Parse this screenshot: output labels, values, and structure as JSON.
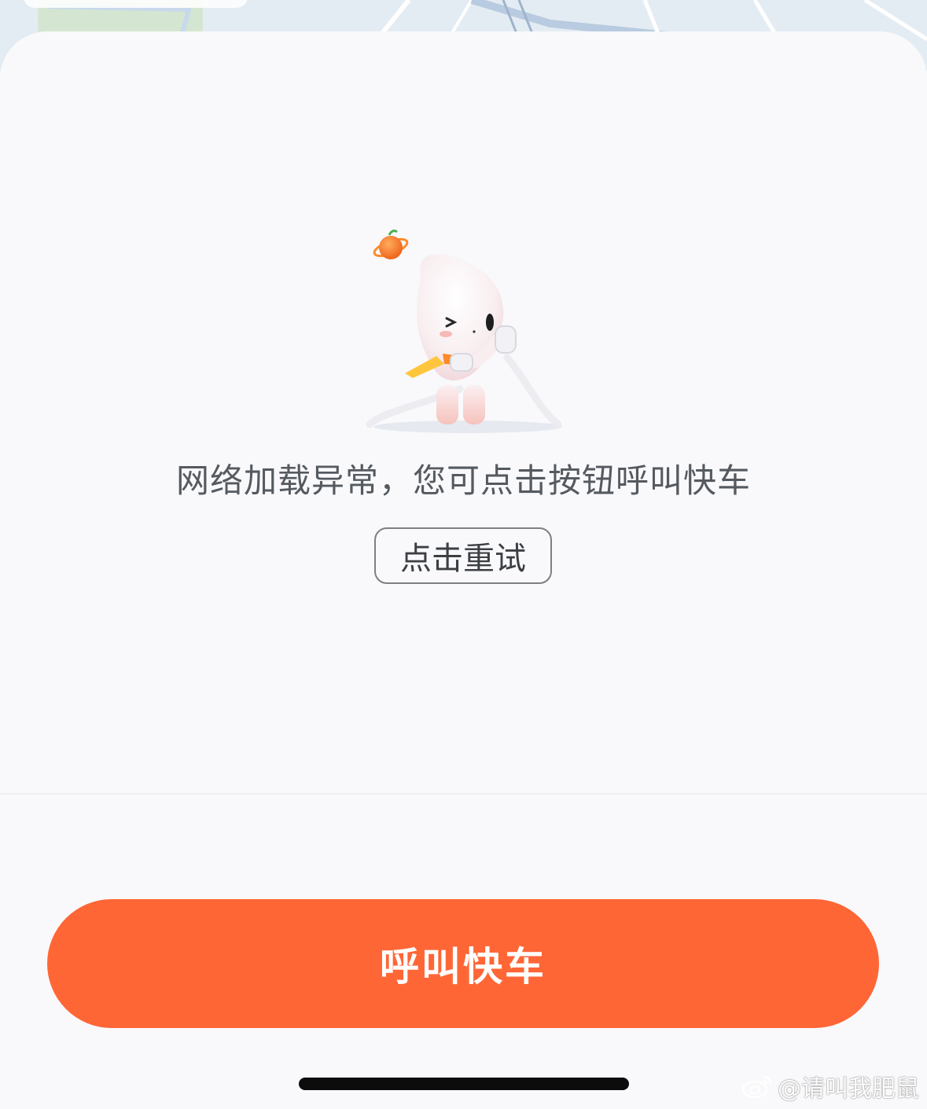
{
  "error": {
    "message": "网络加载异常，您可点击按钮呼叫快车",
    "retry_label": "点击重试"
  },
  "primary_action": {
    "label": "呼叫快车",
    "color": "#ff6636"
  },
  "watermark": {
    "text": "@请叫我肥鼠",
    "icon": "weibo-icon"
  },
  "mascot": {
    "icon": "mascot-holding-plugs"
  },
  "colors": {
    "sheet_background": "#f9f9fb",
    "text_secondary": "#555a60",
    "accent": "#ff6636"
  }
}
